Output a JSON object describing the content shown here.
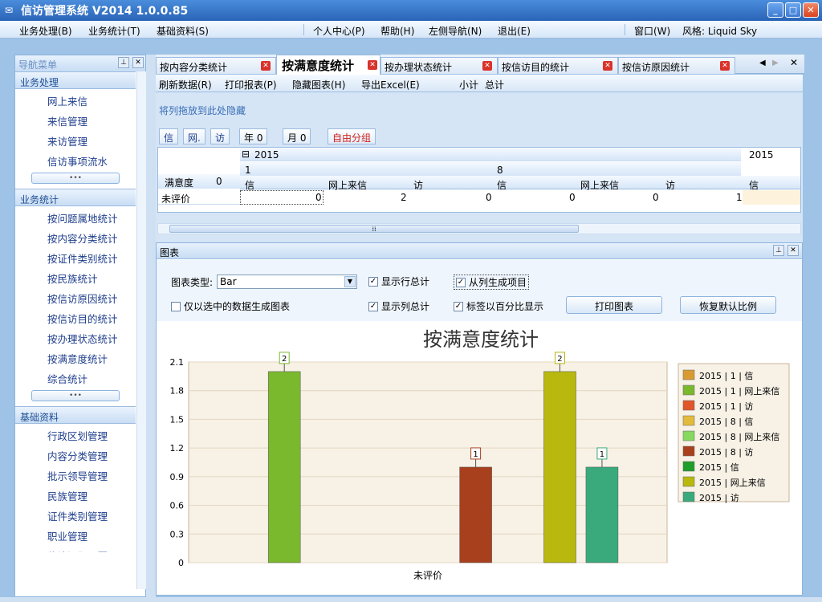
{
  "window": {
    "title": "信访管理系统 V2014 1.0.0.85"
  },
  "menu": {
    "left": [
      "业务处理(B)",
      "业务统计(T)",
      "基础资料(S)"
    ],
    "center": [
      "个人中心(P)",
      "帮助(H)",
      "左侧导航(N)",
      "退出(E)"
    ],
    "right": [
      "窗口(W)",
      "风格: Liquid Sky"
    ]
  },
  "sidebar": {
    "title": "导航菜单",
    "sections": [
      {
        "title": "业务处理",
        "items": [
          "网上来信",
          "来信管理",
          "来访管理",
          "信访事项流水"
        ]
      },
      {
        "title": "业务统计",
        "items": [
          "按问题属地统计",
          "按内容分类统计",
          "按证件类别统计",
          "按民族统计",
          "按信访原因统计",
          "按信访目的统计",
          "按办理状态统计",
          "按满意度统计",
          "综合统计"
        ]
      },
      {
        "title": "基础资料",
        "items": [
          "行政区划管理",
          "内容分类管理",
          "批示领导管理",
          "民族管理",
          "证件类别管理",
          "职业管理",
          "信访问题原因"
        ]
      }
    ]
  },
  "tabs": [
    "按内容分类统计",
    "按满意度统计",
    "按办理状态统计",
    "按信访目的统计",
    "按信访原因统计"
  ],
  "toolbar": [
    "刷新数据(R)",
    "打印报表(P)",
    "隐藏图表(H)",
    "导出Excel(E)",
    "小计",
    "总计"
  ],
  "pivot": {
    "drop_hint": "将列拖放到此处隐藏",
    "field_buttons": [
      "信",
      "网.",
      "访",
      "年 0",
      "月 0",
      "自由分组"
    ],
    "year_label": "2015",
    "year_label_right": "2015",
    "month1": "1",
    "month2": "8",
    "row_field": "满意度",
    "row_field_count": "0",
    "col_headers": [
      "信",
      "网上来信",
      "访",
      "信",
      "网上来信",
      "访",
      "信"
    ],
    "row_label": "未评价",
    "values": [
      "0",
      "2",
      "0",
      "0",
      "0",
      "1",
      ""
    ]
  },
  "chart_panel": {
    "title": "图表",
    "chart_type_label": "图表类型:",
    "chart_type_value": "Bar",
    "checks": [
      {
        "label": "显示行总计",
        "checked": true
      },
      {
        "label": "从列生成项目",
        "checked": true
      },
      {
        "label": "仅以选中的数据生成图表",
        "checked": false
      },
      {
        "label": "显示列总计",
        "checked": true
      },
      {
        "label": "标签以百分比显示",
        "checked": true
      }
    ],
    "print_button": "打印图表",
    "reset_button": "恢复默认比例"
  },
  "chart_data": {
    "type": "bar",
    "title": "按满意度统计",
    "categories": [
      "未评价"
    ],
    "ylim": [
      0,
      2.1
    ],
    "yticks": [
      "0",
      "0.3",
      "0.6",
      "0.9",
      "1.2",
      "1.5",
      "1.8",
      "2.1"
    ],
    "series": [
      {
        "name": "2015 | 1 | 信",
        "values": [
          0
        ],
        "color": "#d99a32"
      },
      {
        "name": "2015 | 1 | 网上来信",
        "values": [
          2
        ],
        "color": "#7ab82e"
      },
      {
        "name": "2015 | 1 | 访",
        "values": [
          0
        ],
        "color": "#e0552a"
      },
      {
        "name": "2015 | 8 | 信",
        "values": [
          0
        ],
        "color": "#e2bb3c"
      },
      {
        "name": "2015 | 8 | 网上来信",
        "values": [
          0
        ],
        "color": "#86d860"
      },
      {
        "name": "2015 | 8 | 访",
        "values": [
          1
        ],
        "color": "#a8401e"
      },
      {
        "name": "2015 | 信",
        "values": [
          0
        ],
        "color": "#1f9e2a"
      },
      {
        "name": "2015 | 网上来信",
        "values": [
          2
        ],
        "color": "#b8b80e"
      },
      {
        "name": "2015 | 访",
        "values": [
          1
        ],
        "color": "#3aaa7c"
      }
    ],
    "grid": true,
    "legend": "right"
  }
}
